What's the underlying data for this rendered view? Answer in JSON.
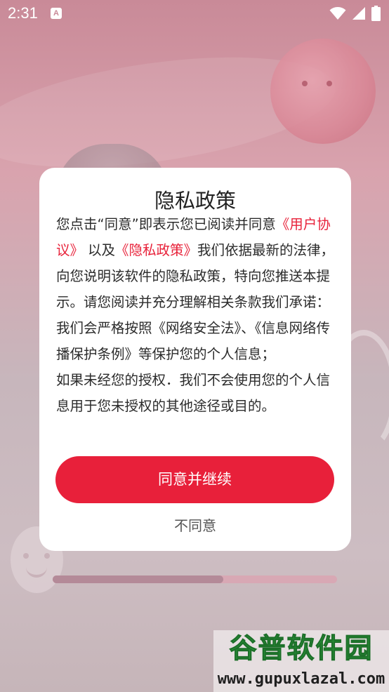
{
  "status_bar": {
    "time": "2:31",
    "notification_letter": "A"
  },
  "background": {
    "load_progress": 0.6
  },
  "dialog": {
    "title": "隐私政策",
    "body": {
      "p1_prefix": "您点击“同意”即表示您已阅读并同意",
      "user_agreement_link": "《用户协议》",
      "p1_middle": "以及",
      "privacy_policy_link": "《隐私政策》",
      "p1_suffix": "我们依据最新的法律，向您说明该软件的隐私政策，特向您推送本提示。请您阅读并充分理解相关条款我们承诺：",
      "p2": "我们会严格按照《网络安全法》、《信息网络传播保护条例》等保护您的个人信息；",
      "p3": "如果未经您的授权．我们不会使用您的个人信息用于您未授权的其他途径或目的。"
    },
    "agree_label": "同意并继续",
    "disagree_label": "不同意"
  },
  "watermark": {
    "title": "谷普软件园",
    "url": "www.gupuxlazal.com"
  },
  "colors": {
    "accent": "#e8203a",
    "link": "#e8223a",
    "watermark_green": "#2a9a3a"
  },
  "icons": [
    "wifi-icon",
    "cellular-signal-icon",
    "battery-icon",
    "notification-a-icon"
  ]
}
